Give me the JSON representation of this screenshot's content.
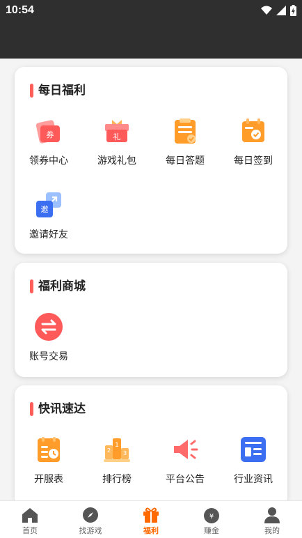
{
  "status_bar": {
    "time": "10:54"
  },
  "sections": [
    {
      "title": "每日福利",
      "items": [
        {
          "label": "领券中心",
          "icon": "coupon-icon"
        },
        {
          "label": "游戏礼包",
          "icon": "gift-box-icon"
        },
        {
          "label": "每日答题",
          "icon": "quiz-icon"
        },
        {
          "label": "每日签到",
          "icon": "calendar-check-icon"
        },
        {
          "label": "邀请好友",
          "icon": "invite-icon"
        }
      ]
    },
    {
      "title": "福利商城",
      "items": [
        {
          "label": "账号交易",
          "icon": "exchange-icon"
        }
      ]
    },
    {
      "title": "快讯速达",
      "items": [
        {
          "label": "开服表",
          "icon": "server-schedule-icon"
        },
        {
          "label": "排行榜",
          "icon": "podium-icon"
        },
        {
          "label": "平台公告",
          "icon": "megaphone-icon"
        },
        {
          "label": "行业资讯",
          "icon": "news-icon"
        }
      ]
    }
  ],
  "tab_bar": {
    "tabs": [
      {
        "label": "首页",
        "icon": "home-icon"
      },
      {
        "label": "找游戏",
        "icon": "compass-icon"
      },
      {
        "label": "福利",
        "icon": "gift-icon"
      },
      {
        "label": "赚金",
        "icon": "money-bag-icon"
      },
      {
        "label": "我的",
        "icon": "user-icon"
      }
    ],
    "active": "福利",
    "active_color": "#ff6a00"
  },
  "colors": {
    "accent_bar": "#ff5f59",
    "top_bar": "#2f2f2f"
  }
}
